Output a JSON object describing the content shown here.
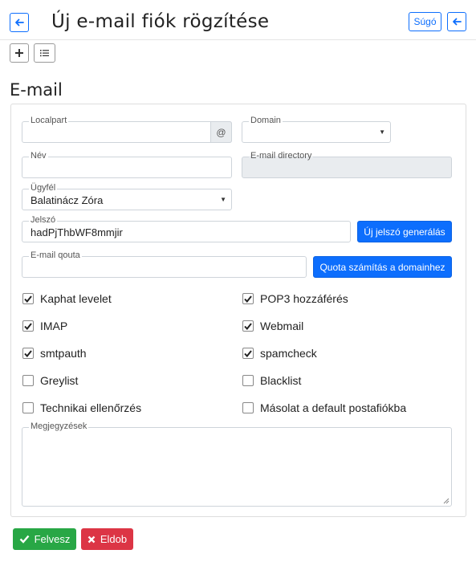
{
  "header": {
    "title": "Új e-mail fiók rögzítése",
    "help_label": "Súgó"
  },
  "section": {
    "title": "E-mail"
  },
  "fields": {
    "localpart": {
      "label": "Localpart",
      "value": "",
      "addon": "@"
    },
    "domain": {
      "label": "Domain",
      "value": ""
    },
    "name": {
      "label": "Név",
      "value": ""
    },
    "directory": {
      "label": "E-mail directory",
      "value": ""
    },
    "client": {
      "label": "Ügyfél",
      "value": "Balatinácz Zóra"
    },
    "password": {
      "label": "Jelszó",
      "value": "hadPjThbWF8mmjir"
    },
    "quota": {
      "label": "E-mail qouta",
      "value": ""
    },
    "notes": {
      "label": "Megjegyzések",
      "value": ""
    }
  },
  "buttons": {
    "generate_password": "Új jelszó generálás",
    "quota_calc": "Quota számítás a domainhez",
    "save": "Felvesz",
    "discard": "Eldob"
  },
  "checkboxes": [
    {
      "label": "Kaphat levelet",
      "checked": true
    },
    {
      "label": "POP3 hozzáférés",
      "checked": true
    },
    {
      "label": "IMAP",
      "checked": true
    },
    {
      "label": "Webmail",
      "checked": true
    },
    {
      "label": "smtpauth",
      "checked": true
    },
    {
      "label": "spamcheck",
      "checked": true
    },
    {
      "label": "Greylist",
      "checked": false
    },
    {
      "label": "Blacklist",
      "checked": false
    },
    {
      "label": "Technikai ellenőrzés",
      "checked": false
    },
    {
      "label": "Másolat a default postafiókba",
      "checked": false
    }
  ],
  "colors": {
    "primary": "#0d6efd",
    "success": "#28a745",
    "danger": "#dc3545"
  }
}
